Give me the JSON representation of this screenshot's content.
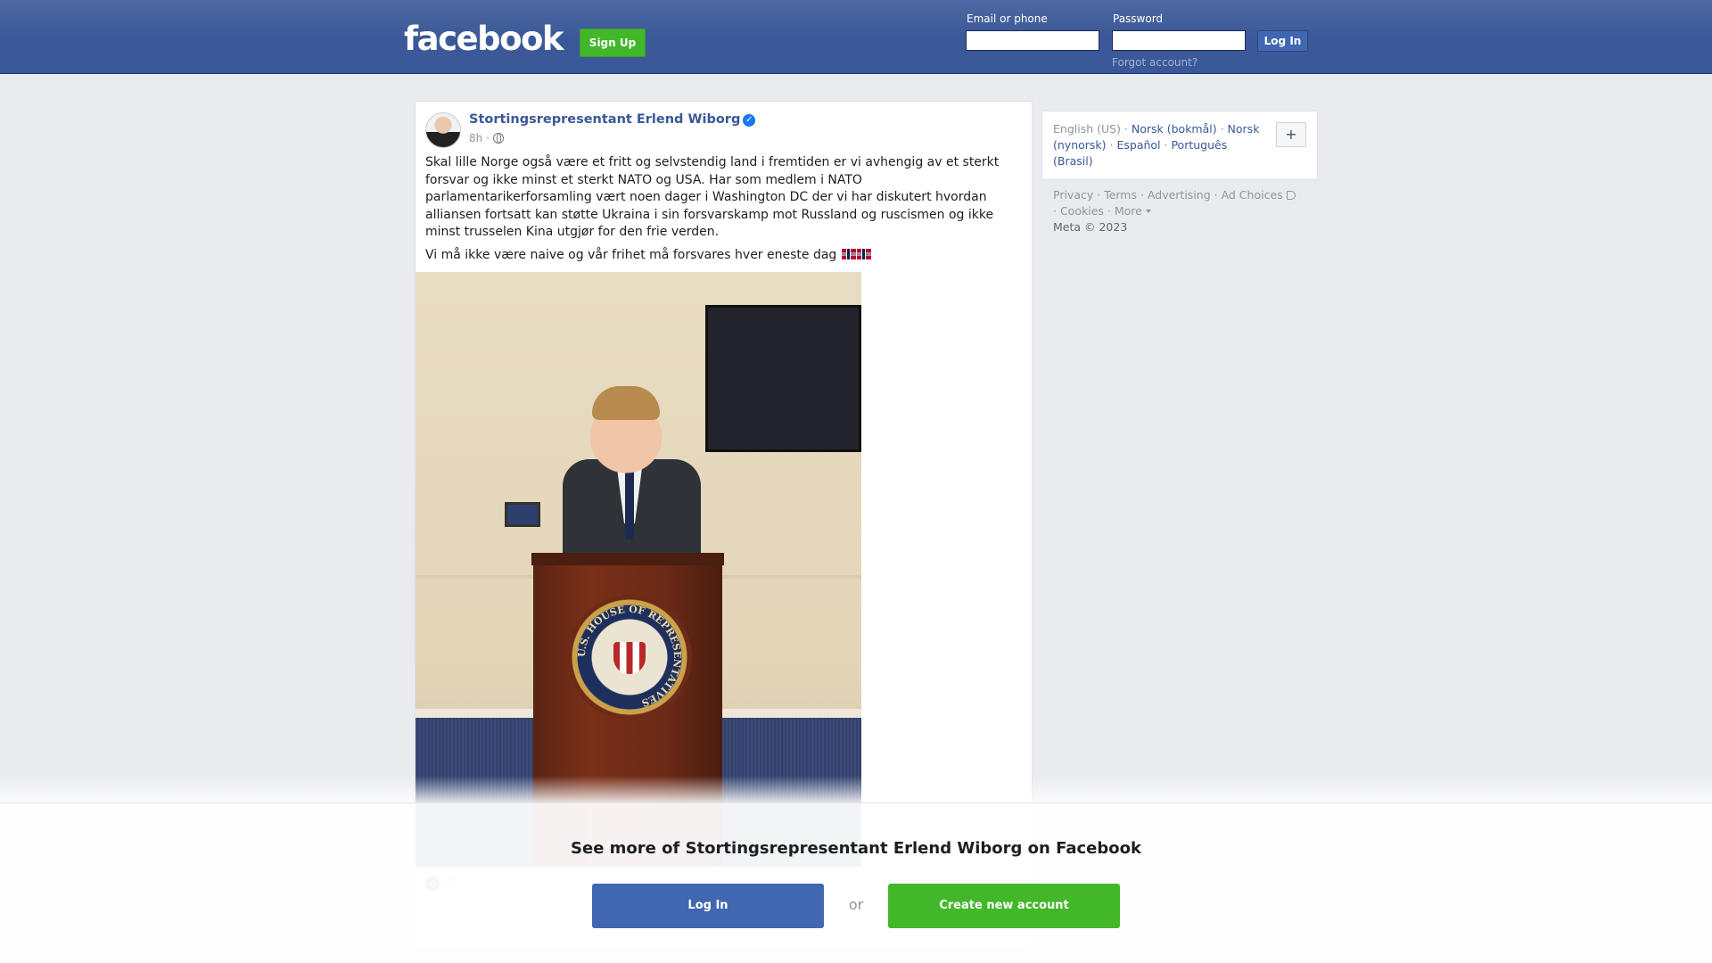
{
  "header": {
    "logo": "facebook",
    "signup_label": "Sign Up",
    "email_label": "Email or phone",
    "password_label": "Password",
    "login_label": "Log In",
    "forgot_label": "Forgot account?"
  },
  "post": {
    "author": "Stortingsrepresentant Erlend Wiborg",
    "time": "8h",
    "paragraph1": "Skal lille Norge også være et fritt og selvstendig land i fremtiden er vi avhengig av et sterkt forsvar og ikke minst et sterkt NATO og USA. Har som medlem i NATO parlamentarikerforsamling vært noen dager i Washington DC der vi har diskutert hvordan alliansen fortsatt kan støtte Ukraina i sin forsvarskamp mot Russland og ruscismen og ikke minst trusselen Kina utgjør for den frie verden.",
    "paragraph2": "Vi må ikke være naive og vår frihet må forsvares hver eneste dag",
    "photo_seal_text": "U.S. HOUSE OF REPRESENTATIVES",
    "likes": "65"
  },
  "sidebar": {
    "languages": {
      "current": "English (US)",
      "links": [
        "Norsk (bokmål)",
        "Norsk (nynorsk)",
        "Español",
        "Português (Brasil)"
      ]
    },
    "plus_label": "+",
    "footer": {
      "privacy": "Privacy",
      "terms": "Terms",
      "advertising": "Advertising",
      "ad_choices": "Ad Choices",
      "cookies": "Cookies",
      "more": "More",
      "copyright": "Meta © 2023"
    }
  },
  "overlay": {
    "title": "See more of Stortingsrepresentant Erlend Wiborg on Facebook",
    "login_label": "Log In",
    "or_label": "or",
    "create_label": "Create new account"
  },
  "colors": {
    "brand_blue": "#3b5998",
    "link_blue": "#385898",
    "green": "#42b72a"
  }
}
